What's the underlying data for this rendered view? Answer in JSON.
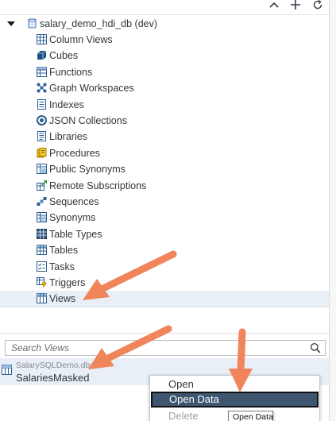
{
  "toolbar": {
    "icons": [
      "collapse-icon",
      "add-icon",
      "refresh-icon"
    ]
  },
  "tree": {
    "root": {
      "label": "salary_demo_hdi_db (dev)",
      "icon": "database-icon",
      "expanded": true
    },
    "items": [
      {
        "label": "Column Views",
        "icon": "column-views-icon"
      },
      {
        "label": "Cubes",
        "icon": "cube-icon"
      },
      {
        "label": "Functions",
        "icon": "functions-icon"
      },
      {
        "label": "Graph Workspaces",
        "icon": "graph-workspace-icon"
      },
      {
        "label": "Indexes",
        "icon": "indexes-icon"
      },
      {
        "label": "JSON Collections",
        "icon": "json-collections-icon"
      },
      {
        "label": "Libraries",
        "icon": "libraries-icon"
      },
      {
        "label": "Procedures",
        "icon": "procedures-icon"
      },
      {
        "label": "Public Synonyms",
        "icon": "public-synonyms-icon"
      },
      {
        "label": "Remote Subscriptions",
        "icon": "remote-subscriptions-icon"
      },
      {
        "label": "Sequences",
        "icon": "sequences-icon"
      },
      {
        "label": "Synonyms",
        "icon": "synonyms-icon"
      },
      {
        "label": "Table Types",
        "icon": "table-types-icon"
      },
      {
        "label": "Tables",
        "icon": "tables-icon"
      },
      {
        "label": "Tasks",
        "icon": "tasks-icon"
      },
      {
        "label": "Triggers",
        "icon": "triggers-icon"
      },
      {
        "label": "Views",
        "icon": "views-icon",
        "selected": true
      }
    ]
  },
  "search": {
    "placeholder": "Search Views"
  },
  "result": {
    "schema": "SalarySQLDemo.db::",
    "name": "SalariesMasked"
  },
  "context_menu": {
    "items": [
      {
        "label": "Open"
      },
      {
        "label": "Open Data",
        "active": true
      },
      {
        "label": "Delete",
        "disabled": true
      }
    ]
  },
  "tooltip": {
    "text": "Open Data"
  },
  "colors": {
    "selection": "#e8eff6",
    "menu_active": "#3e5670",
    "annotation_arrow": "#f0845a",
    "icon_blue": "#2c5d8f"
  }
}
